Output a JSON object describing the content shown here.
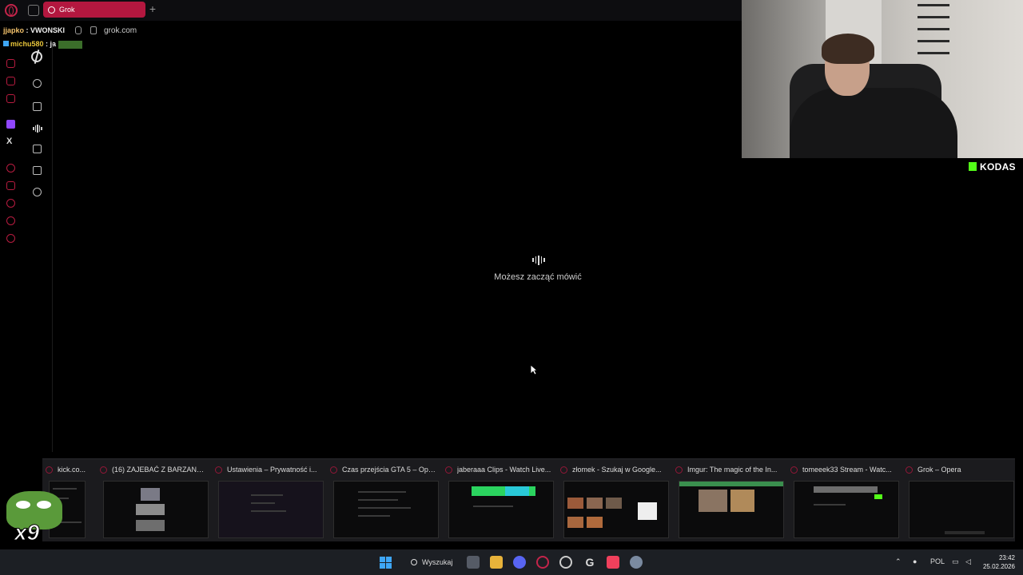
{
  "browser": {
    "tab_title": "Grok",
    "url": "grok.com",
    "new_tab": "+"
  },
  "chat": {
    "line1_nick": "jjapko",
    "line1_sep": " : ",
    "line1_text": "VWONSKI",
    "line2_nick": "michu580",
    "line2_sep": " : ",
    "line2_text": "ja"
  },
  "grok": {
    "voice_prompt": "Możesz zacząć mówić"
  },
  "overlay": {
    "brand": "KODAS",
    "emote_count": "x9"
  },
  "switcher": {
    "items": [
      {
        "title": "kick.co..."
      },
      {
        "title": "(16) ZAJEBAĆ Z BARZANTA..."
      },
      {
        "title": "Ustawienia – Prywatność i..."
      },
      {
        "title": "Czas przejścia GTA 5 – Ope..."
      },
      {
        "title": "jaberaaa Clips - Watch Live..."
      },
      {
        "title": "złomek - Szukaj w Google..."
      },
      {
        "title": "Imgur: The magic of the In..."
      },
      {
        "title": "tomeeek33 Stream - Watc..."
      },
      {
        "title": "Grok – Opera"
      }
    ]
  },
  "taskbar": {
    "search_label": "Wyszukaj",
    "language": "POL",
    "time": "23:42",
    "date": "25.02.2026"
  },
  "colors": {
    "opera_red": "#b3173f",
    "twitch_purple": "#9147ff",
    "kick_green": "#53fc18",
    "windows_blue": "#3ea6f5"
  }
}
